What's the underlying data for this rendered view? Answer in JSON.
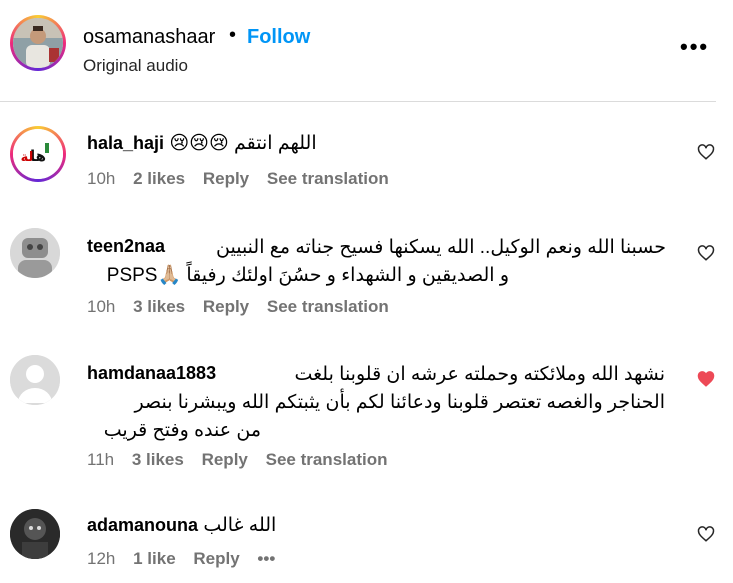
{
  "post": {
    "username": "osamanashaar",
    "separator": "•",
    "follow_label": "Follow",
    "audio_label": "Original audio",
    "more_icon": "•••"
  },
  "comments": [
    {
      "username": "hala_haji",
      "text": "اللهم انتقم 😢😢😢",
      "time": "10h",
      "likes": "2 likes",
      "reply": "Reply",
      "translate": "See translation",
      "liked": false
    },
    {
      "username": "teen2naa",
      "text_line1": "حسبنا الله ونعم الوكيل.. الله يسكنها فسيح جناته مع النبيين",
      "text_line2": "و الصديقين و الشهداء و حسُنَ اولئك رفيقاً 🙏🏼PSPS",
      "time": "10h",
      "likes": "3 likes",
      "reply": "Reply",
      "translate": "See translation",
      "liked": false
    },
    {
      "username": "hamdanaa1883",
      "text_line1": "نشهد الله وملائكته وحملته عرشه ان قلوبنا بلغت",
      "text_line2": "الحناجر والغصه تعتصر قلوبنا ودعائنا لكم بأن يثبتكم الله ويبشرنا بنصر",
      "text_line3": "من عنده وفتح قريب",
      "time": "11h",
      "likes": "3 likes",
      "reply": "Reply",
      "translate": "See translation",
      "liked": true
    },
    {
      "username": "adamanouna",
      "text": "الله غالب",
      "time": "12h",
      "likes": "1 like",
      "reply": "Reply",
      "more": "•••",
      "liked": false
    }
  ],
  "colors": {
    "follow": "#0095f6",
    "meta": "#737373",
    "liked_heart": "#ed4956"
  }
}
